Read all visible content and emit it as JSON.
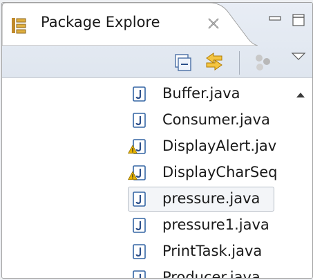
{
  "view": {
    "tab_title": "Package Explore",
    "icons": {
      "tab": "package-explorer-icon",
      "close": "close-icon",
      "minimize": "minimize-icon",
      "maximize": "maximize-icon",
      "collapse_all": "collapse-all-icon",
      "link_editor": "link-with-editor-icon",
      "focus": "focus-icon",
      "view_menu": "view-menu-icon"
    }
  },
  "tree": {
    "items": [
      {
        "label": "Buffer.java",
        "warning": false,
        "selected": false
      },
      {
        "label": "Consumer.java",
        "warning": false,
        "selected": false
      },
      {
        "label": "DisplayAlert.jav",
        "warning": true,
        "selected": false
      },
      {
        "label": "DisplayCharSeq",
        "warning": true,
        "selected": false
      },
      {
        "label": "pressure.java",
        "warning": false,
        "selected": true
      },
      {
        "label": "pressure1.java",
        "warning": false,
        "selected": false
      },
      {
        "label": "PrintTask.java",
        "warning": false,
        "selected": false
      },
      {
        "label": "Producer.java",
        "warning": false,
        "selected": false
      }
    ]
  },
  "colors": {
    "java_icon_border": "#3465a4",
    "java_icon_letter": "#2c4f8a",
    "warning": "#e8b400",
    "link_icon": "#e6a100"
  }
}
